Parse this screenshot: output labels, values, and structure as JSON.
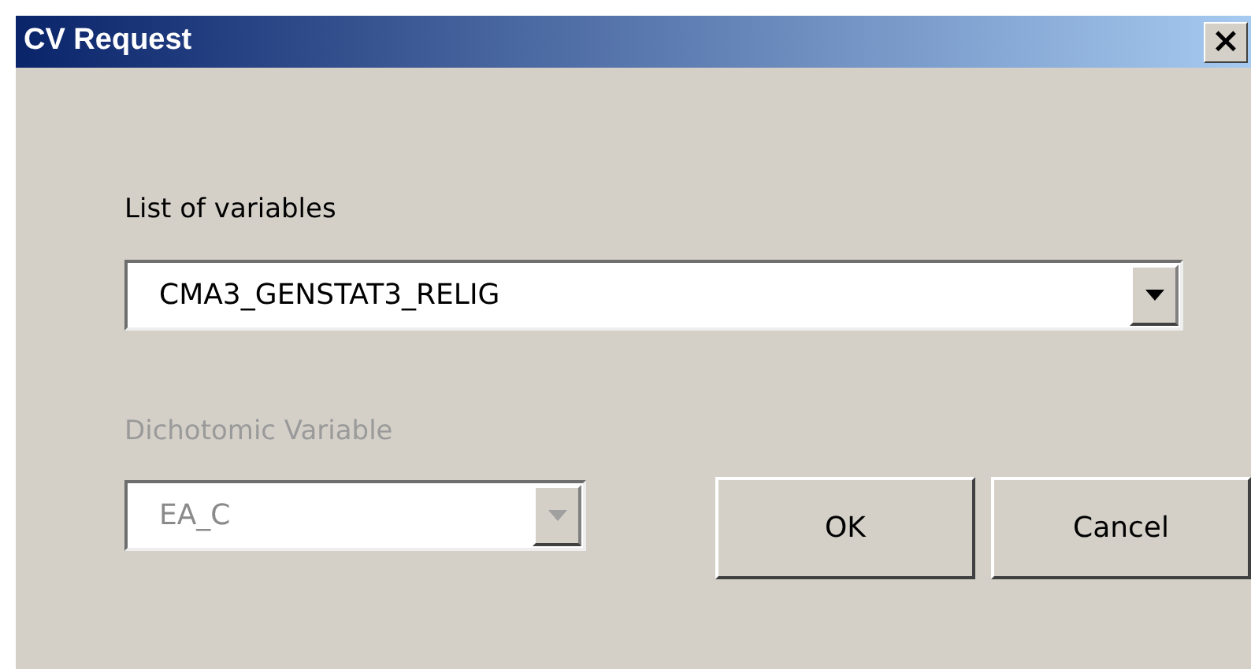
{
  "window": {
    "title": "CV Request",
    "close": "×"
  },
  "list_of_variables": {
    "label": "List of variables",
    "value": "CMA3_GENSTAT3_RELIG",
    "disabled": false
  },
  "dichotomic_variable": {
    "label": "Dichotomic Variable",
    "value": "EA_C",
    "disabled": true
  },
  "buttons": [
    "OK",
    "Cancel"
  ]
}
